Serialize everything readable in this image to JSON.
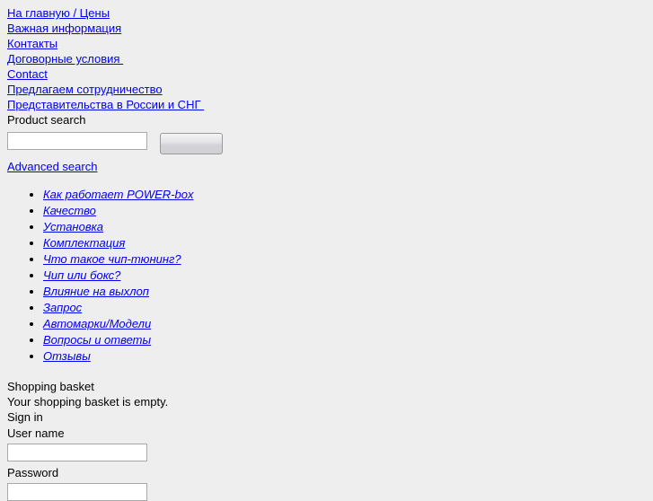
{
  "nav": {
    "links": [
      {
        "label": "На главную / Цены"
      },
      {
        "label": "Важная информация"
      },
      {
        "label": "Контакты"
      },
      {
        "label": "Договорные условия "
      },
      {
        "label": "Contact"
      },
      {
        "label": "Предлагаем сотрудничество"
      },
      {
        "label": "Представительства в России и СНГ "
      }
    ]
  },
  "search": {
    "heading": "Product search",
    "value": "",
    "placeholder": "",
    "button_label": "",
    "advanced_label": "Advanced search"
  },
  "menu": {
    "items": [
      {
        "label": "Как работает POWER-box"
      },
      {
        "label": "Качество"
      },
      {
        "label": "Установка"
      },
      {
        "label": "Комплектация"
      },
      {
        "label": "Что такое чип-тюнинг?"
      },
      {
        "label": "Чип или бокс?"
      },
      {
        "label": "Влияние на выхлоп"
      },
      {
        "label": "Запрос"
      },
      {
        "label": "Автомарки/Модели"
      },
      {
        "label": "Вопросы и ответы"
      },
      {
        "label": "Отзывы"
      }
    ]
  },
  "basket": {
    "heading": "Shopping basket",
    "empty_message": "Your shopping basket is empty."
  },
  "signin": {
    "heading": "Sign in",
    "username_label": "User name",
    "username_value": "",
    "password_label": "Password",
    "password_value": ""
  },
  "colors": {
    "background": "#eeeeee",
    "link": "#0000ee",
    "text": "#000000",
    "input_border": "#a9a9a9"
  }
}
